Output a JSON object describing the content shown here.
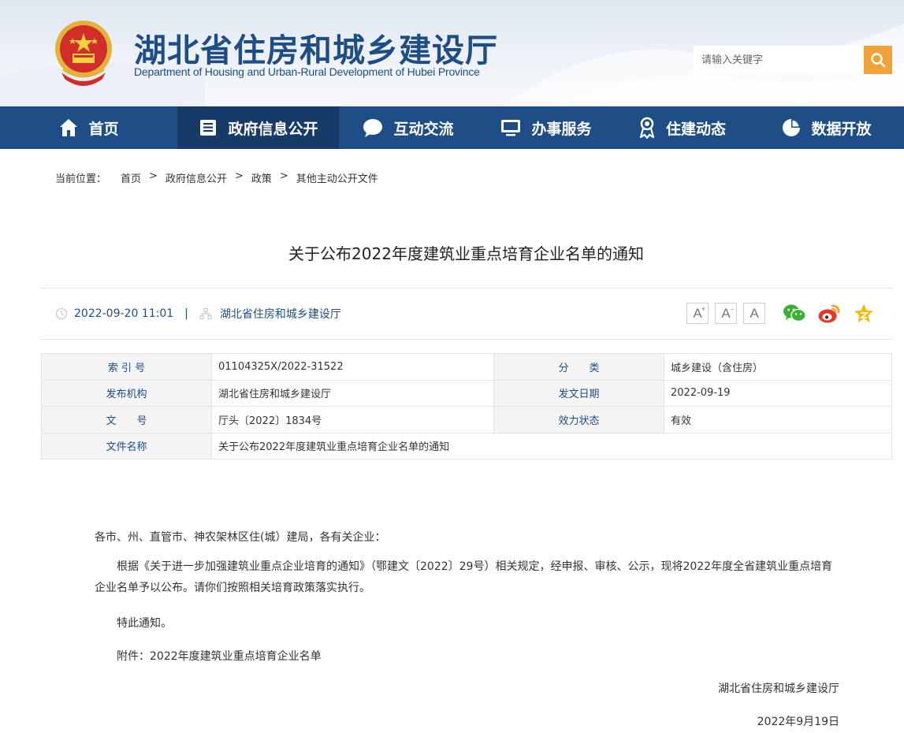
{
  "header": {
    "title": "湖北省住房和城乡建设厅",
    "subtitle": "Department of Housing and Urban-Rural Development of Hubei Province",
    "search_placeholder": "请输入关键字",
    "emblem_icon": "national-emblem-icon"
  },
  "colors": {
    "primary": "#1f4e86",
    "nav_active": "#163b69",
    "search_button": "#f2a23a"
  },
  "nav": {
    "items": [
      {
        "label": "首页",
        "icon": "home-icon"
      },
      {
        "label": "政府信息公开",
        "icon": "document-list-icon",
        "active": true
      },
      {
        "label": "互动交流",
        "icon": "chat-bubble-icon"
      },
      {
        "label": "办事服务",
        "icon": "monitor-icon"
      },
      {
        "label": "住建动态",
        "icon": "award-person-icon"
      },
      {
        "label": "数据开放",
        "icon": "pie-chart-icon"
      }
    ]
  },
  "breadcrumb": {
    "label": "当前位置：",
    "items": [
      "首页",
      "政府信息公开",
      "政策",
      "其他主动公开文件"
    ],
    "separator": ">"
  },
  "article": {
    "title": "关于公布2022年度建筑业重点培育企业名单的通知",
    "datetime": "2022-09-20 11:01",
    "divider": "|",
    "source": "湖北省住房和城乡建设厅",
    "font_sizes": [
      "A",
      "A",
      "A"
    ],
    "font_size_marks": [
      "+",
      "-"
    ]
  },
  "info": {
    "index_label": "索 引 号",
    "index_value": "01104325X/2022-31522",
    "category_label": "分　　类",
    "category_value": "城乡建设（含住房）",
    "publisher_label": "发布机构",
    "publisher_value": "湖北省住房和城乡建设厅",
    "date_label": "发文日期",
    "date_value": "2022-09-19",
    "docno_label": "文　　号",
    "docno_value": "厅头〔2022〕1834号",
    "status_label": "效力状态",
    "status_value": "有效",
    "name_label": "文件名称",
    "name_value": "关于公布2022年度建筑业重点培育企业名单的通知"
  },
  "body": {
    "salutation": "各市、州、直管市、神农架林区住(城）建局，各有关企业：",
    "para1": "根据《关于进一步加强建筑业重点企业培育的通知》（鄂建文〔2022〕29号）相关规定，经申报、审核、公示，现将2022年度全省建筑业重点培育企业名单予以公布。请你们按照相关培育政策落实执行。",
    "para2": "特此通知。",
    "attachment": "附件：2022年度建筑业重点培育企业名单",
    "signature": "湖北省住房和城乡建设厅",
    "date": "2022年9月19日"
  }
}
